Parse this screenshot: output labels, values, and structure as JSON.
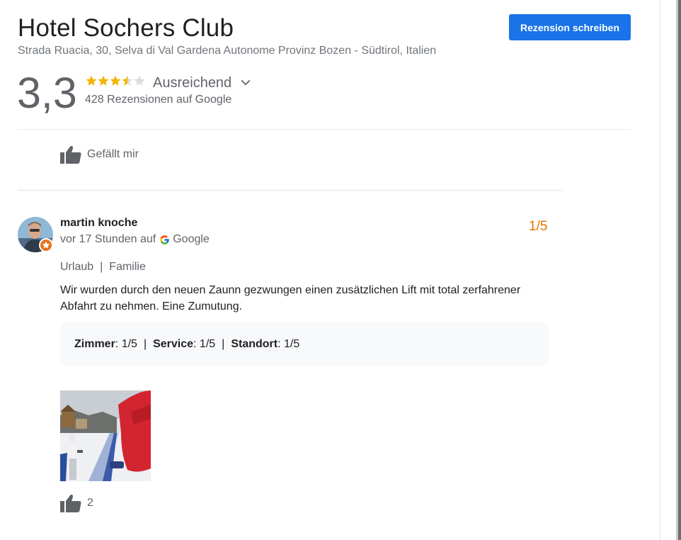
{
  "hotel": {
    "name": "Hotel Sochers Club",
    "address": "Strada Ruacia, 30, Selva di Val Gardena Autonome Provinz Bozen - Südtirol, Italien",
    "write_review_label": "Rezension schreiben"
  },
  "summary": {
    "rating": "3,3",
    "stars_value": 3.3,
    "stars_max": 5,
    "rating_label": "Ausreichend",
    "review_count": "428 Rezensionen auf Google",
    "like_label": "Gefällt mir"
  },
  "review": {
    "author": "martin knoche",
    "meta_prefix": "vor 17 Stunden auf",
    "source": "Google",
    "score": "1/5",
    "trip_type": "Urlaub",
    "travel_group": "Familie",
    "trip_separator": "|",
    "text": "Wir wurden durch den neuen Zaunn gezwungen einen zusätzlichen Lift mit total zerfahrener Abfahrt zu nehmen. Eine Zumutung.",
    "subratings": [
      {
        "label": "Zimmer",
        "value": ": 1/5"
      },
      {
        "label": "Service",
        "value": ": 1/5"
      },
      {
        "label": "Standort",
        "value": ": 1/5"
      }
    ],
    "subrating_separator": "|",
    "likes": "2"
  },
  "colors": {
    "accent": "#1a73e8",
    "star": "#f4b400",
    "star_empty": "#dadce0",
    "score": "#e37400"
  },
  "icons": [
    "star-icon",
    "chevron-down-icon",
    "thumbs-up-icon",
    "google-g-icon",
    "local-guide-badge-icon"
  ]
}
